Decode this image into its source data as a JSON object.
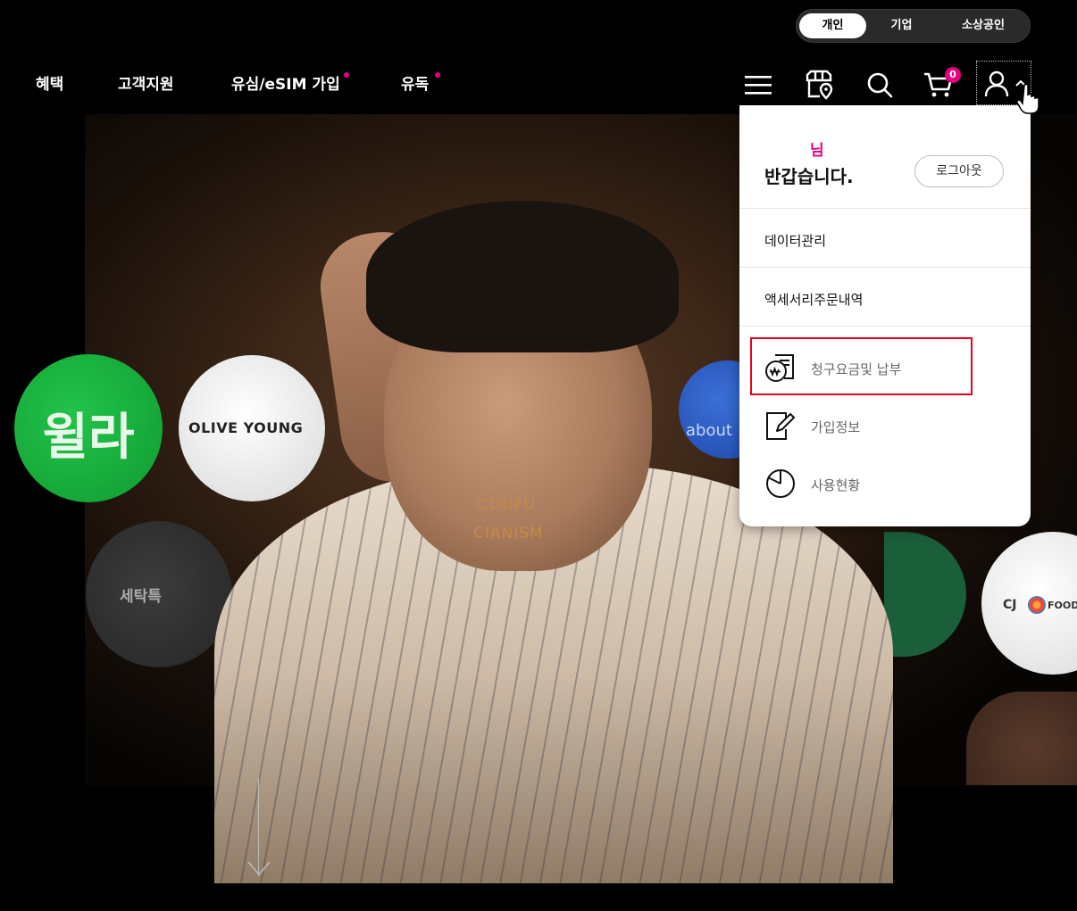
{
  "segment": {
    "items": [
      "개인",
      "기업",
      "소상공인"
    ],
    "active": "개인"
  },
  "nav": {
    "items": [
      {
        "label": "혜택",
        "dot": false
      },
      {
        "label": "고객지원",
        "dot": false
      },
      {
        "label": "유심/eSIM 가입",
        "dot": true
      },
      {
        "label": "유독",
        "dot": true
      }
    ]
  },
  "header_icons": {
    "menu": "hamburger-menu-icon",
    "store": "store-location-icon",
    "search": "search-icon",
    "cart": "cart-icon",
    "cart_count": "0",
    "user": "user-icon"
  },
  "hero": {
    "brands": {
      "willa": "윌라",
      "olive_young": "OLIVE YOUNG",
      "laundry": "세탁특",
      "about": "about",
      "cj": "CJ",
      "cj_food": "FOOD",
      "confucianism_1": "CONFU",
      "confucianism_2": "CIANISM"
    }
  },
  "dropdown": {
    "name_suffix": "님",
    "greeting": "반갑습니다.",
    "logout_label": "로그아웃",
    "menu_items": [
      "데이터관리",
      "액세서리주문내역"
    ],
    "sub_items": [
      {
        "label": "청구요금및 납부",
        "icon": "bill-payment-icon"
      },
      {
        "label": "가입정보",
        "icon": "edit-document-icon"
      },
      {
        "label": "사용현황",
        "icon": "usage-chart-icon"
      }
    ]
  },
  "colors": {
    "accent": "#e6007e",
    "highlight": "#e8001c",
    "background": "#000000"
  }
}
